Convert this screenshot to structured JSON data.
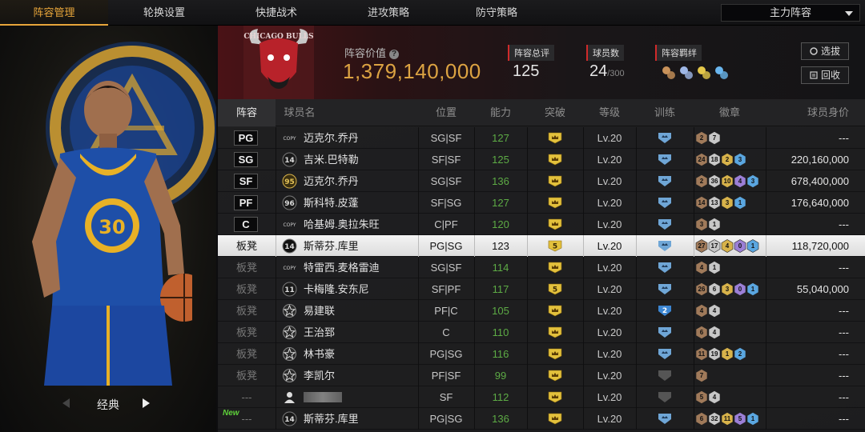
{
  "nav": {
    "tabs": [
      {
        "label": "阵容管理",
        "active": true
      },
      {
        "label": "轮换设置",
        "active": false
      },
      {
        "label": "快捷战术",
        "active": false
      },
      {
        "label": "进攻策略",
        "active": false
      },
      {
        "label": "防守策略",
        "active": false
      }
    ],
    "lineup_select": "主力阵容"
  },
  "hero": {
    "player_jersey": "30",
    "style_label": "经典"
  },
  "header": {
    "team_logo_text": "CHICAGO BULLS",
    "value_label": "阵容价值",
    "value": "1,379,140,000",
    "rating_label": "阵容总评",
    "rating": "125",
    "players_label": "球员数",
    "players_count": "24",
    "players_max": "/300",
    "bond_label": "阵容羁绊",
    "select_button": "选拔",
    "recycle_button": "回收"
  },
  "table": {
    "headers": [
      "阵容",
      "球员名",
      "位置",
      "能力",
      "突破",
      "等级",
      "训练",
      "徽章",
      "球员身价"
    ],
    "rows": [
      {
        "slot": "PG",
        "starter": true,
        "card": "COPY",
        "name": "迈克尔.乔丹",
        "pos": "SG|SF",
        "ability": "127",
        "break": "crown",
        "level": "Lv.20",
        "train": "blue",
        "badges": [
          [
            "bronze",
            "2"
          ],
          [
            "silver",
            "7"
          ]
        ],
        "price": "---",
        "highlight": false,
        "new": false
      },
      {
        "slot": "SG",
        "starter": true,
        "card": "14",
        "name": "吉米.巴特勒",
        "pos": "SF|SF",
        "ability": "125",
        "break": "crown",
        "level": "Lv.20",
        "train": "blue",
        "badges": [
          [
            "bronze",
            "24"
          ],
          [
            "silver",
            "18"
          ],
          [
            "gold",
            "2"
          ],
          [
            "blue",
            "3"
          ]
        ],
        "price": "220,160,000",
        "highlight": false,
        "new": false
      },
      {
        "slot": "SF",
        "starter": true,
        "card": "95",
        "name": "迈克尔.乔丹",
        "pos": "SG|SF",
        "ability": "136",
        "break": "crown",
        "level": "Lv.20",
        "train": "blue",
        "badges": [
          [
            "bronze",
            "2"
          ],
          [
            "silver",
            "36"
          ],
          [
            "gold",
            "10"
          ],
          [
            "purple",
            "4"
          ],
          [
            "blue",
            "3"
          ]
        ],
        "price": "678,400,000",
        "highlight": false,
        "new": false
      },
      {
        "slot": "PF",
        "starter": true,
        "card": "96",
        "name": "斯科特.皮蓬",
        "pos": "SF|SG",
        "ability": "127",
        "break": "crown",
        "level": "Lv.20",
        "train": "blue",
        "badges": [
          [
            "bronze",
            "14"
          ],
          [
            "silver",
            "13"
          ],
          [
            "gold",
            "3"
          ],
          [
            "blue",
            "1"
          ]
        ],
        "price": "176,640,000",
        "highlight": false,
        "new": false
      },
      {
        "slot": "C",
        "starter": true,
        "card": "COPY",
        "name": "哈基姆.奥拉朱旺",
        "pos": "C|PF",
        "ability": "120",
        "break": "crown",
        "level": "Lv.20",
        "train": "blue",
        "badges": [
          [
            "bronze",
            "3"
          ],
          [
            "silver",
            "1"
          ]
        ],
        "price": "---",
        "highlight": false,
        "new": false
      },
      {
        "slot": "板凳",
        "starter": false,
        "card": "14",
        "name": "斯蒂芬.库里",
        "pos": "PG|SG",
        "ability": "123",
        "break": "5",
        "level": "Lv.20",
        "train": "blue",
        "badges": [
          [
            "bronze",
            "27"
          ],
          [
            "silver",
            "17"
          ],
          [
            "gold",
            "4"
          ],
          [
            "purple",
            "0"
          ],
          [
            "blue",
            "1"
          ]
        ],
        "price": "118,720,000",
        "highlight": true,
        "new": false
      },
      {
        "slot": "板凳",
        "starter": false,
        "card": "COPY",
        "name": "特雷西.麦格雷迪",
        "pos": "SG|SF",
        "ability": "114",
        "break": "crown",
        "level": "Lv.20",
        "train": "blue",
        "badges": [
          [
            "bronze",
            "4"
          ],
          [
            "silver",
            "1"
          ]
        ],
        "price": "---",
        "highlight": false,
        "new": false
      },
      {
        "slot": "板凳",
        "starter": false,
        "card": "11",
        "name": "卡梅隆.安东尼",
        "pos": "SF|PF",
        "ability": "117",
        "break": "5",
        "level": "Lv.20",
        "train": "blue",
        "badges": [
          [
            "bronze",
            "26"
          ],
          [
            "silver",
            "6"
          ],
          [
            "gold",
            "3"
          ],
          [
            "purple",
            "0"
          ],
          [
            "blue",
            "1"
          ]
        ],
        "price": "55,040,000",
        "highlight": false,
        "new": false
      },
      {
        "slot": "板凳",
        "starter": false,
        "card": "star",
        "name": "易建联",
        "pos": "PF|C",
        "ability": "105",
        "break": "crown",
        "level": "Lv.20",
        "train": "2",
        "badges": [
          [
            "bronze",
            "4"
          ],
          [
            "silver",
            "4"
          ]
        ],
        "price": "---",
        "highlight": false,
        "new": false
      },
      {
        "slot": "板凳",
        "starter": false,
        "card": "star",
        "name": "王治郅",
        "pos": "C",
        "ability": "110",
        "break": "crown",
        "level": "Lv.20",
        "train": "blue",
        "badges": [
          [
            "bronze",
            "6"
          ],
          [
            "silver",
            "4"
          ]
        ],
        "price": "---",
        "highlight": false,
        "new": false
      },
      {
        "slot": "板凳",
        "starter": false,
        "card": "star",
        "name": "林书豪",
        "pos": "PG|SG",
        "ability": "116",
        "break": "crown",
        "level": "Lv.20",
        "train": "blue",
        "badges": [
          [
            "bronze",
            "11"
          ],
          [
            "silver",
            "19"
          ],
          [
            "gold",
            "1"
          ],
          [
            "blue",
            "2"
          ]
        ],
        "price": "---",
        "highlight": false,
        "new": false
      },
      {
        "slot": "板凳",
        "starter": false,
        "card": "star",
        "name": "李凯尔",
        "pos": "PF|SF",
        "ability": "99",
        "break": "crown",
        "level": "Lv.20",
        "train": "grey",
        "badges": [
          [
            "bronze",
            "7"
          ]
        ],
        "price": "---",
        "highlight": false,
        "new": false
      },
      {
        "slot": "---",
        "starter": false,
        "card": "avatar",
        "name": "",
        "pos": "SF",
        "ability": "112",
        "break": "crown",
        "level": "Lv.20",
        "train": "grey",
        "badges": [
          [
            "bronze",
            "5"
          ],
          [
            "silver",
            "4"
          ]
        ],
        "price": "---",
        "highlight": false,
        "new": false
      },
      {
        "slot": "---",
        "starter": false,
        "card": "14",
        "name": "斯蒂芬.库里",
        "pos": "PG|SG",
        "ability": "136",
        "break": "crown",
        "level": "Lv.20",
        "train": "blue",
        "badges": [
          [
            "bronze",
            "6"
          ],
          [
            "silver",
            "32"
          ],
          [
            "gold",
            "11"
          ],
          [
            "purple",
            "5"
          ],
          [
            "blue",
            "1"
          ]
        ],
        "price": "---",
        "highlight": false,
        "new": true,
        "new_label": "New"
      }
    ]
  },
  "colors": {
    "accent": "#e7a53a",
    "value_gold": "#dca342",
    "ability_green": "#5dab45",
    "bronze": "#a07a5a",
    "silver": "#c7c7c7",
    "gold": "#d7b24a",
    "purple": "#9b7fd6",
    "blue": "#5aa6e0"
  }
}
